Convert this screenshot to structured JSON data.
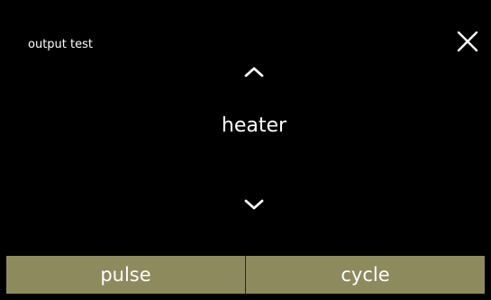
{
  "header": {
    "title": "output test"
  },
  "selector": {
    "current_item": "heater"
  },
  "icons": {
    "close": "close-icon",
    "up": "chevron-up-icon",
    "down": "chevron-down-icon"
  },
  "buttons": {
    "pulse_label": "pulse",
    "cycle_label": "cycle"
  },
  "colors": {
    "background": "#000000",
    "text": "#ffffff",
    "button_bg": "#8d8a5e",
    "divider": "#2b2a1a"
  }
}
